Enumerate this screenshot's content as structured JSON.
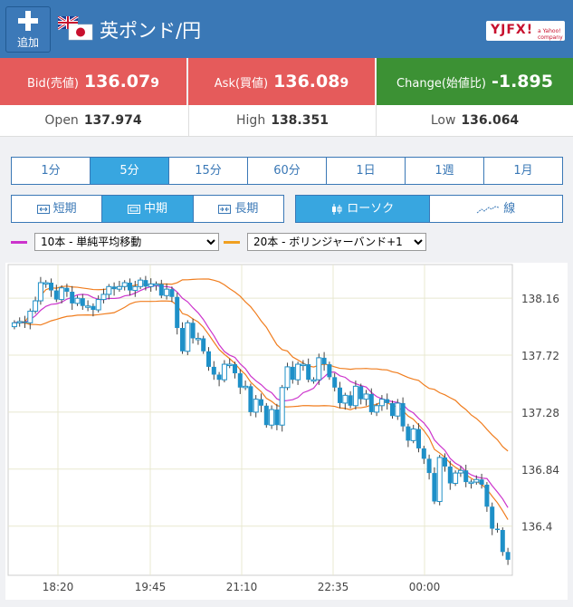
{
  "header": {
    "add_label": "追加",
    "pair_name": "英ポンド/円",
    "logo_text": "YJFX!",
    "logo_sub": "a Yahoo! company"
  },
  "quotes": {
    "bid_label": "Bid(売値)",
    "bid_main": "136.07",
    "bid_pip": "9",
    "ask_label": "Ask(買値)",
    "ask_main": "136.08",
    "ask_pip": "9",
    "change_label": "Change(始値比)",
    "change_value": "-1.895"
  },
  "stats": {
    "open_label": "Open",
    "open_value": "137.974",
    "high_label": "High",
    "high_value": "138.351",
    "low_label": "Low",
    "low_value": "136.064"
  },
  "timeframes": [
    "1分",
    "5分",
    "15分",
    "60分",
    "1日",
    "1週",
    "1月"
  ],
  "selected_timeframe": "5分",
  "terms": [
    "短期",
    "中期",
    "長期"
  ],
  "selected_term": "中期",
  "chart_types": [
    "ローソク",
    "線"
  ],
  "selected_chart_type": "ローソク",
  "indicators": {
    "ma_value": "10本 - 単純平均移動",
    "ma_color": "#cc33cc",
    "bb_value": "20本 - ボリンジャーバンド+1",
    "bb_color": "#f0a020"
  },
  "colors": {
    "header": "#3a78b6",
    "bid_ask": "#e55b5b",
    "change": "#3c9134",
    "accent": "#38a6e0",
    "candle": "#1e90c8",
    "bb_line": "#f07d1e"
  },
  "chart_data": {
    "type": "candlestick",
    "y_ticks": [
      "138.16",
      "137.72",
      "137.28",
      "136.84",
      "136.4"
    ],
    "x_ticks": [
      "18:20",
      "19:45",
      "21:10",
      "22:35",
      "00:00"
    ],
    "ylim": [
      136.02,
      138.42
    ],
    "close": [
      137.97,
      137.98,
      137.97,
      138.06,
      138.14,
      138.28,
      138.28,
      138.22,
      138.15,
      138.24,
      138.21,
      138.12,
      138.16,
      138.1,
      138.1,
      138.07,
      138.15,
      138.19,
      138.25,
      138.23,
      138.25,
      138.28,
      138.22,
      138.25,
      138.3,
      138.25,
      138.27,
      138.27,
      138.18,
      138.23,
      138.17,
      137.93,
      137.75,
      137.97,
      137.85,
      137.85,
      137.75,
      137.63,
      137.57,
      137.53,
      137.65,
      137.65,
      137.58,
      137.47,
      137.48,
      137.28,
      137.38,
      137.33,
      137.18,
      137.3,
      137.18,
      137.47,
      137.63,
      137.53,
      137.65,
      137.65,
      137.53,
      137.53,
      137.7,
      137.65,
      137.55,
      137.47,
      137.35,
      137.41,
      137.33,
      137.48,
      137.38,
      137.42,
      137.28,
      137.33,
      137.38,
      137.35,
      137.25,
      137.35,
      137.17,
      137.06,
      137.15,
      137.0,
      136.92,
      136.81,
      136.59,
      136.93,
      136.86,
      136.73,
      136.81,
      136.83,
      136.74,
      136.74,
      136.76,
      136.72,
      136.55,
      136.38,
      136.37,
      136.2,
      136.14
    ]
  }
}
